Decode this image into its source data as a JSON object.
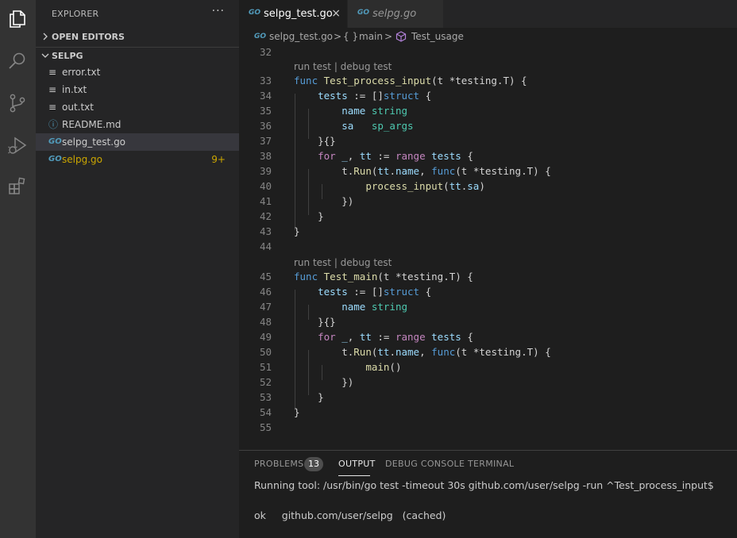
{
  "activity_bar": {
    "icons": [
      "files-icon",
      "search-icon",
      "source-control-icon",
      "run-debug-icon",
      "extensions-icon"
    ]
  },
  "sidebar": {
    "title": "EXPLORER",
    "more": "···",
    "open_editors_label": "OPEN EDITORS",
    "folder_label": "SELPG",
    "files": [
      {
        "name": "error.txt",
        "icon": "≡"
      },
      {
        "name": "in.txt",
        "icon": "≡"
      },
      {
        "name": "out.txt",
        "icon": "≡"
      },
      {
        "name": "README.md",
        "icon": "ⓘ"
      },
      {
        "name": "selpg_test.go",
        "icon": "GO"
      },
      {
        "name": "selpg.go",
        "icon": "GO",
        "badge": "9+"
      }
    ]
  },
  "tabs": [
    {
      "label": "selpg_test.go",
      "icon": "GO",
      "close": "×"
    },
    {
      "label": "selpg.go",
      "icon": "GO"
    }
  ],
  "breadcrumb": {
    "file": "selpg_test.go",
    "sep": ">",
    "braces": "{ }",
    "package": "main",
    "symbol": "Test_usage"
  },
  "editor": {
    "codelens": "run test | debug test",
    "lines": [
      {
        "n": "32",
        "code": ""
      },
      {
        "n": "33",
        "code": "func Test_process_input(t *testing.T) {"
      },
      {
        "n": "34",
        "code": "    tests := []struct {"
      },
      {
        "n": "35",
        "code": "        name string"
      },
      {
        "n": "36",
        "code": "        sa   sp_args"
      },
      {
        "n": "37",
        "code": "    }{}"
      },
      {
        "n": "38",
        "code": "    for _, tt := range tests {"
      },
      {
        "n": "39",
        "code": "        t.Run(tt.name, func(t *testing.T) {"
      },
      {
        "n": "40",
        "code": "            process_input(tt.sa)"
      },
      {
        "n": "41",
        "code": "        })"
      },
      {
        "n": "42",
        "code": "    }"
      },
      {
        "n": "43",
        "code": "}"
      },
      {
        "n": "44",
        "code": ""
      },
      {
        "n": "45",
        "code": "func Test_main(t *testing.T) {"
      },
      {
        "n": "46",
        "code": "    tests := []struct {"
      },
      {
        "n": "47",
        "code": "        name string"
      },
      {
        "n": "48",
        "code": "    }{}"
      },
      {
        "n": "49",
        "code": "    for _, tt := range tests {"
      },
      {
        "n": "50",
        "code": "        t.Run(tt.name, func(t *testing.T) {"
      },
      {
        "n": "51",
        "code": "            main()"
      },
      {
        "n": "52",
        "code": "        })"
      },
      {
        "n": "53",
        "code": "    }"
      },
      {
        "n": "54",
        "code": "}"
      },
      {
        "n": "55",
        "code": ""
      }
    ]
  },
  "panel": {
    "tabs": [
      {
        "label": "PROBLEMS",
        "badge": "13"
      },
      {
        "label": "OUTPUT"
      },
      {
        "label": "DEBUG CONSOLE"
      },
      {
        "label": "TERMINAL"
      }
    ],
    "active_tab": "OUTPUT",
    "output": [
      "Running tool: /usr/bin/go test -timeout 30s github.com/user/selpg -run ^Test_process_input$",
      "ok     github.com/user/selpg   (cached)"
    ]
  },
  "colors": {
    "keyword": "#569cd6",
    "function": "#dcdcaa",
    "type": "#4ec9b0",
    "variable": "#9cdcfe",
    "control": "#c586c0",
    "warning": "#cca700",
    "go_icon": "#519aba"
  }
}
